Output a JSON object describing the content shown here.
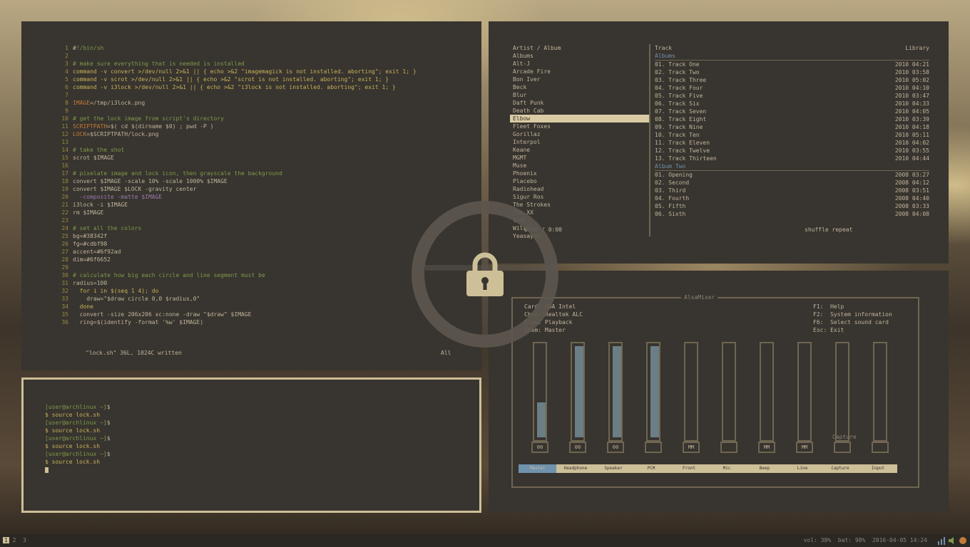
{
  "editor": {
    "lines": [
      {
        "n": "1",
        "segs": [
          {
            "t": "#",
            "c": "c-light"
          },
          {
            "t": "!/bin/sh",
            "c": "c-green"
          }
        ]
      },
      {
        "n": "2",
        "segs": []
      },
      {
        "n": "3",
        "segs": [
          {
            "t": "# make sure everything that is needed is installed",
            "c": "c-green"
          }
        ]
      },
      {
        "n": "4",
        "segs": [
          {
            "t": "command -v convert >/dev/null 2>&1 || { echo >&2 \"imagemagick is not installed. aborting\"; exit 1; }",
            "c": "c-yellow"
          }
        ]
      },
      {
        "n": "5",
        "segs": [
          {
            "t": "command -v scrot >/dev/null 2>&1 || { echo >&2 \"scrot is not installed. aborting\"; exit 1; }",
            "c": "c-yellow"
          }
        ]
      },
      {
        "n": "6",
        "segs": [
          {
            "t": "command -v i3lock >/dev/null 2>&1 || { echo >&2 \"i3lock is not installed. aborting\"; exit 1; }",
            "c": "c-yellow"
          }
        ]
      },
      {
        "n": "7",
        "segs": []
      },
      {
        "n": "8",
        "segs": [
          {
            "t": "IMAGE",
            "c": "c-orange"
          },
          {
            "t": "=/tmp/i3lock.png",
            "c": "c-light"
          }
        ]
      },
      {
        "n": "9",
        "segs": []
      },
      {
        "n": "10",
        "segs": [
          {
            "t": "# get the lock image from script's directory",
            "c": "c-green"
          }
        ]
      },
      {
        "n": "11",
        "segs": [
          {
            "t": "SCRIPTPATH",
            "c": "c-orange"
          },
          {
            "t": "=$( cd $(dirname $0) ; pwd -P )",
            "c": "c-light"
          }
        ]
      },
      {
        "n": "12",
        "segs": [
          {
            "t": "LOCK",
            "c": "c-orange"
          },
          {
            "t": "=$SCRIPTPATH/lock.png",
            "c": "c-light"
          }
        ]
      },
      {
        "n": "13",
        "segs": []
      },
      {
        "n": "14",
        "segs": [
          {
            "t": "# take the shot",
            "c": "c-green"
          }
        ]
      },
      {
        "n": "15",
        "segs": [
          {
            "t": "scrot $IMAGE",
            "c": "c-light"
          }
        ]
      },
      {
        "n": "16",
        "segs": []
      },
      {
        "n": "17",
        "segs": [
          {
            "t": "# pixelate image and lock icon, then grayscale the background",
            "c": "c-green"
          }
        ]
      },
      {
        "n": "18",
        "segs": [
          {
            "t": "convert $IMAGE -scale 10% -scale 1000% $IMAGE",
            "c": "c-light"
          }
        ]
      },
      {
        "n": "19",
        "segs": [
          {
            "t": "convert $IMAGE $LOCK -gravity center",
            "c": "c-light"
          }
        ]
      },
      {
        "n": "20",
        "segs": [
          {
            "t": "  -composite -matte $IMAGE",
            "c": "c-purple"
          }
        ]
      },
      {
        "n": "21",
        "segs": [
          {
            "t": "i3lock -i $IMAGE",
            "c": "c-light"
          }
        ]
      },
      {
        "n": "22",
        "segs": [
          {
            "t": "rm $IMAGE",
            "c": "c-light"
          }
        ]
      },
      {
        "n": "23",
        "segs": []
      },
      {
        "n": "24",
        "segs": [
          {
            "t": "# set all the colors",
            "c": "c-green"
          }
        ]
      },
      {
        "n": "25",
        "segs": [
          {
            "t": "bg=#38342f",
            "c": "c-light"
          }
        ]
      },
      {
        "n": "26",
        "segs": [
          {
            "t": "fg=#cdbf98",
            "c": "c-light"
          }
        ]
      },
      {
        "n": "27",
        "segs": [
          {
            "t": "accent=#6f92ad",
            "c": "c-light"
          }
        ]
      },
      {
        "n": "28",
        "segs": [
          {
            "t": "dim=#6f6652",
            "c": "c-light"
          }
        ]
      },
      {
        "n": "29",
        "segs": []
      },
      {
        "n": "30",
        "segs": [
          {
            "t": "# calculate how big each circle and line segment must be",
            "c": "c-green"
          }
        ]
      },
      {
        "n": "31",
        "segs": [
          {
            "t": "radius=100",
            "c": "c-light"
          }
        ]
      },
      {
        "n": "32",
        "segs": [
          {
            "t": "  for i in $(seq 1 4); do",
            "c": "c-yellow"
          }
        ]
      },
      {
        "n": "33",
        "segs": [
          {
            "t": "    draw=\"$draw circle 0,0 $radius,0\"",
            "c": "c-light"
          }
        ]
      },
      {
        "n": "34",
        "segs": [
          {
            "t": "  done",
            "c": "c-yellow"
          }
        ]
      },
      {
        "n": "35",
        "segs": [
          {
            "t": "  convert -size 206x206 xc:none -draw \"$draw\" $IMAGE",
            "c": "c-light"
          }
        ]
      },
      {
        "n": "36",
        "segs": [
          {
            "t": "  ring=$(identify -format '%w' $IMAGE)",
            "c": "c-light"
          }
        ]
      }
    ],
    "status_left": "\"lock.sh\" 36L, 1024C written",
    "status_right": "All"
  },
  "terminal": {
    "lines": [
      {
        "segs": [
          {
            "t": "[user@archlinux ~]",
            "c": "c-green"
          },
          {
            "t": "$ ",
            "c": "c-light"
          }
        ]
      },
      {
        "segs": [
          {
            "t": "$ source lock.sh",
            "c": "c-yellow"
          }
        ]
      },
      {
        "segs": [
          {
            "t": "[user@archlinux ~]",
            "c": "c-green"
          },
          {
            "t": "$ ",
            "c": "c-light"
          }
        ]
      },
      {
        "segs": [
          {
            "t": "$ source lock.sh",
            "c": "c-yellow"
          }
        ]
      },
      {
        "segs": [
          {
            "t": "[user@archlinux ~]",
            "c": "c-green"
          },
          {
            "t": "$ ",
            "c": "c-light"
          }
        ]
      },
      {
        "segs": [
          {
            "t": "$ source lock.sh",
            "c": "c-yellow"
          }
        ]
      },
      {
        "segs": [
          {
            "t": "[user@archlinux ~]",
            "c": "c-green"
          },
          {
            "t": "$ ",
            "c": "c-light"
          }
        ]
      },
      {
        "segs": [
          {
            "t": "$ source lock.sh",
            "c": "c-yellow"
          }
        ]
      }
    ]
  },
  "music": {
    "library_header": "Artist / Album",
    "library": [
      "Albums",
      "Alt-J",
      "Arcade Fire",
      "Bon Iver",
      "Beck",
      "Blur",
      "Daft Punk",
      "Death Cab",
      "Elbow",
      "Fleet Foxes",
      "Gorillaz",
      "Interpol",
      "Keane",
      "MGMT",
      "Muse",
      "Phoenix",
      "Placebo",
      "Radiohead",
      "Sigur Ros",
      "The Strokes",
      "The XX",
      "Tool",
      "Wilco",
      "Yeasayer"
    ],
    "selected_index": 8,
    "tracks_header": "Track",
    "tracks_header_right": "Library",
    "album1": "Albums",
    "tracks1": [
      {
        "t": "01. Track One",
        "r": "2010 04:21"
      },
      {
        "t": "02. Track Two",
        "r": "2010 03:58"
      },
      {
        "t": "03. Track Three",
        "r": "2010 05:02"
      },
      {
        "t": "04. Track Four",
        "r": "2010 04:10"
      },
      {
        "t": "05. Track Five",
        "r": "2010 03:47"
      },
      {
        "t": "06. Track Six",
        "r": "2010 04:33"
      },
      {
        "t": "07. Track Seven",
        "r": "2010 04:05"
      },
      {
        "t": "08. Track Eight",
        "r": "2010 03:39"
      },
      {
        "t": "09. Track Nine",
        "r": "2010 04:18"
      },
      {
        "t": "10. Track Ten",
        "r": "2010 05:11"
      },
      {
        "t": "11. Track Eleven",
        "r": "2010 04:02"
      },
      {
        "t": "12. Track Twelve",
        "r": "2010 03:55"
      },
      {
        "t": "13. Track Thirteen",
        "r": "2010 04:44"
      }
    ],
    "album2": "Album Two",
    "tracks2": [
      {
        "t": "01. Opening",
        "r": "2008 03:27"
      },
      {
        "t": "02. Second",
        "r": "2008 04:12"
      },
      {
        "t": "03. Third",
        "r": "2008 03:51"
      },
      {
        "t": "04. Fourth",
        "r": "2008 04:40"
      },
      {
        "t": "05. Fifth",
        "r": "2008 03:33"
      },
      {
        "t": "06. Sixth",
        "r": "2008 04:08"
      }
    ],
    "status_left": "0:00 / 0:00",
    "status_right": "shuffle repeat"
  },
  "mixer": {
    "title": "AlsaMixer",
    "info": "Card: HDA Intel\nChip: Realtek ALC\nView: Playback\nItem: Master",
    "keys": "F1:  Help\nF2:  System information\nF6:  Select sound card\nEsc: Exit",
    "capture_label": "Capture",
    "channels": [
      {
        "label": "Master",
        "level": 0.38,
        "muted": "00",
        "active": true
      },
      {
        "label": "Headphone",
        "level": 1.0,
        "muted": "00",
        "active": false
      },
      {
        "label": "Speaker",
        "level": 1.0,
        "muted": "00",
        "active": false
      },
      {
        "label": "PCM",
        "level": 1.0,
        "muted": "",
        "active": false
      },
      {
        "label": "Front",
        "level": 0.0,
        "muted": "MM",
        "active": false
      },
      {
        "label": "Mic",
        "level": 0.0,
        "muted": "",
        "active": false
      },
      {
        "label": "Beep",
        "level": 0.0,
        "muted": "MM",
        "active": false
      },
      {
        "label": "Line",
        "level": 0.0,
        "muted": "MM",
        "active": false
      },
      {
        "label": "Capture",
        "level": 0.0,
        "muted": "",
        "active": false
      },
      {
        "label": "Input",
        "level": 0.0,
        "muted": "",
        "active": false
      }
    ]
  },
  "taskbar": {
    "workspace_current": "1",
    "workspaces_rest": " 2  3",
    "status": "vol: 38%  bat: 98%  2016-04-05 14:24"
  },
  "lock": {
    "icon": "padlock-icon",
    "color": "#cdbf98"
  }
}
